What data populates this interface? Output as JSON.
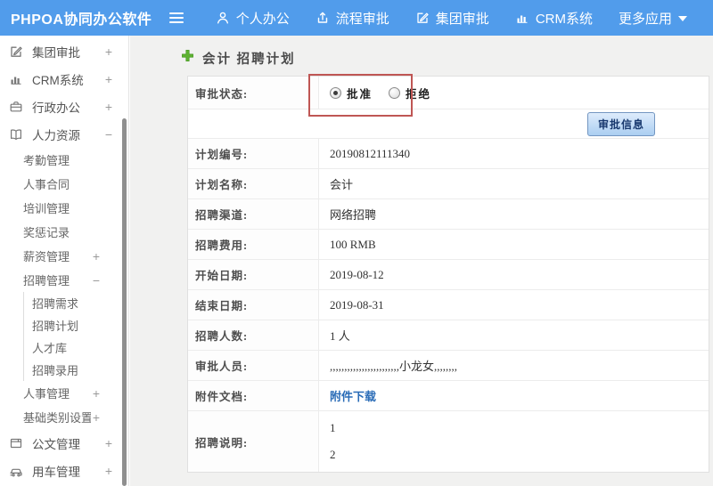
{
  "topbar": {
    "logo": "PHPOA协同办公软件",
    "nav": [
      {
        "name": "nav-personal-office",
        "label": "个人办公",
        "icon": "user-icon"
      },
      {
        "name": "nav-process-approval",
        "label": "流程审批",
        "icon": "process-icon"
      },
      {
        "name": "nav-group-approval",
        "label": "集团审批",
        "icon": "edit-square-icon"
      },
      {
        "name": "nav-crm-system",
        "label": "CRM系统",
        "icon": "bar-chart-icon"
      },
      {
        "name": "nav-more-apps",
        "label": "更多应用",
        "icon": "caret-down-icon",
        "icon_position": "after"
      }
    ]
  },
  "sidebar": {
    "items": [
      {
        "name": "group-approval",
        "label": "集团审批",
        "icon": "edit-square-icon",
        "expander": "+",
        "level": 1
      },
      {
        "name": "crm-system",
        "label": "CRM系统",
        "icon": "bar-chart-icon",
        "expander": "+",
        "level": 1
      },
      {
        "name": "admin-office",
        "label": "行政办公",
        "icon": "briefcase-icon",
        "expander": "+",
        "level": 1
      },
      {
        "name": "human-resources",
        "label": "人力资源",
        "icon": "book-icon",
        "expander": "−",
        "level": 1
      },
      {
        "name": "attendance-management",
        "label": "考勤管理",
        "level": 2
      },
      {
        "name": "hr-contract",
        "label": "人事合同",
        "level": 2
      },
      {
        "name": "training-management",
        "label": "培训管理",
        "level": 2
      },
      {
        "name": "reward-punishment",
        "label": "奖惩记录",
        "level": 2
      },
      {
        "name": "salary-management",
        "label": "薪资管理",
        "expander": "+",
        "level": 2
      },
      {
        "name": "recruitment-management",
        "label": "招聘管理",
        "expander": "−",
        "level": 2
      },
      {
        "name": "recruitment-needs",
        "label": "招聘需求",
        "level": 3
      },
      {
        "name": "recruitment-plan",
        "label": "招聘计划",
        "level": 3
      },
      {
        "name": "talent-pool",
        "label": "人才库",
        "level": 3
      },
      {
        "name": "recruitment-hiring",
        "label": "招聘录用",
        "level": 3
      },
      {
        "name": "personnel-management",
        "label": "人事管理",
        "expander": "+",
        "level": 2
      },
      {
        "name": "basic-category-settings",
        "label": "基础类别设置",
        "expander": "+",
        "level": 2
      },
      {
        "name": "document-management",
        "label": "公文管理",
        "icon": "document-icon",
        "expander": "+",
        "level": 1
      },
      {
        "name": "vehicle-management",
        "label": "用车管理",
        "icon": "car-icon",
        "expander": "+",
        "level": 1
      }
    ]
  },
  "main": {
    "title": "会计 招聘计划",
    "approval_label": "审批状态:",
    "radio_options": [
      {
        "label": "批准",
        "checked": true
      },
      {
        "label": "拒绝",
        "checked": false
      }
    ],
    "button_label": "审批信息",
    "rows": [
      {
        "name": "plan-number",
        "label": "计划编号:",
        "value": "20190812111340"
      },
      {
        "name": "plan-name",
        "label": "计划名称:",
        "value": "会计"
      },
      {
        "name": "recruitment-channel",
        "label": "招聘渠道:",
        "value": "网络招聘"
      },
      {
        "name": "recruitment-cost",
        "label": "招聘费用:",
        "value": "100 RMB"
      },
      {
        "name": "start-date",
        "label": "开始日期:",
        "value": "2019-08-12"
      },
      {
        "name": "end-date",
        "label": "结束日期:",
        "value": "2019-08-31"
      },
      {
        "name": "recruitment-count",
        "label": "招聘人数:",
        "value": "1 人"
      },
      {
        "name": "approvers",
        "label": "审批人员:",
        "value": ",,,,,,,,,,,,,,,,,,,,,,,,小龙女,,,,,,,,"
      },
      {
        "name": "attachment",
        "label": "附件文档:",
        "value": "附件下载",
        "link": true
      },
      {
        "name": "recruitment-notes",
        "label": "招聘说明:",
        "value": "1\n2",
        "tall": true
      }
    ],
    "colors": {
      "topbar_blue": "#519ceb",
      "annotation_red": "#bf5654",
      "link_blue": "#2a6cb7",
      "plus_green": "#5db231"
    }
  }
}
